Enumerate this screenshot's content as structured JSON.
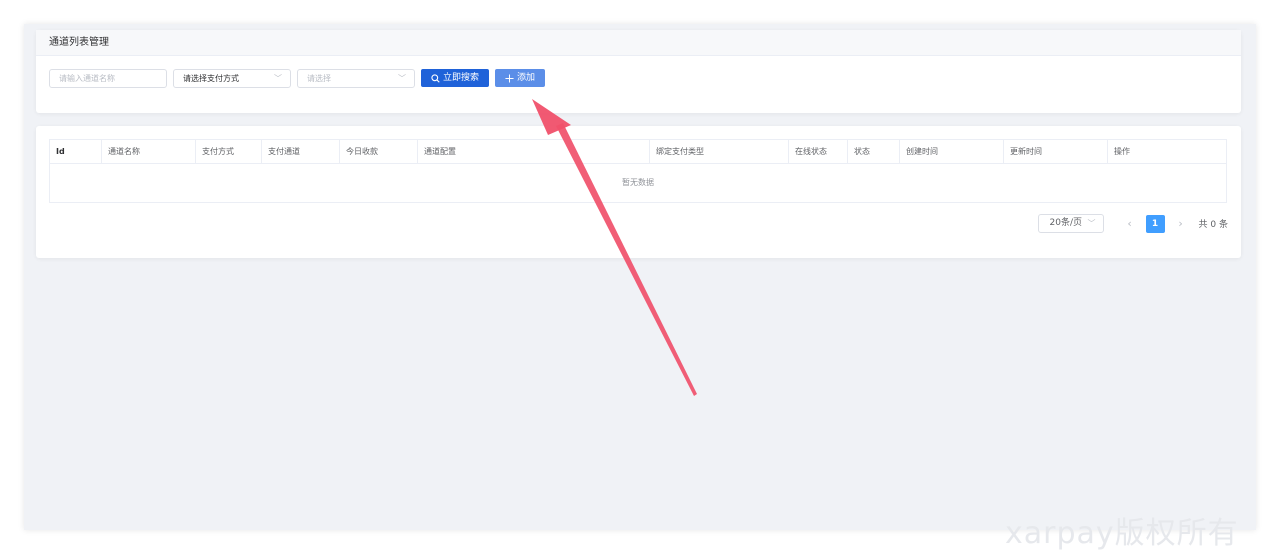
{
  "panel": {
    "title": "通道列表管理"
  },
  "search": {
    "name_placeholder": "请输入通道名称",
    "pay_method_value": "请选择支付方式",
    "select_placeholder": "请选择",
    "search_label": "立即搜索",
    "add_label": "添加"
  },
  "table": {
    "columns": [
      "Id",
      "通道名称",
      "支付方式",
      "支付通道",
      "今日收款",
      "通道配置",
      "绑定支付类型",
      "在线状态",
      "状态",
      "创建时间",
      "更新时间",
      "操作"
    ],
    "empty_text": "暂无数据"
  },
  "pagination": {
    "page_size": "20条/页",
    "current_page": "1",
    "total": "共 0 条"
  },
  "watermark": "xarpay版权所有",
  "colors": {
    "primary": "#1f62d9",
    "add": "#5b8ee8",
    "page_active": "#409eff",
    "arrow": "#f0506a"
  }
}
